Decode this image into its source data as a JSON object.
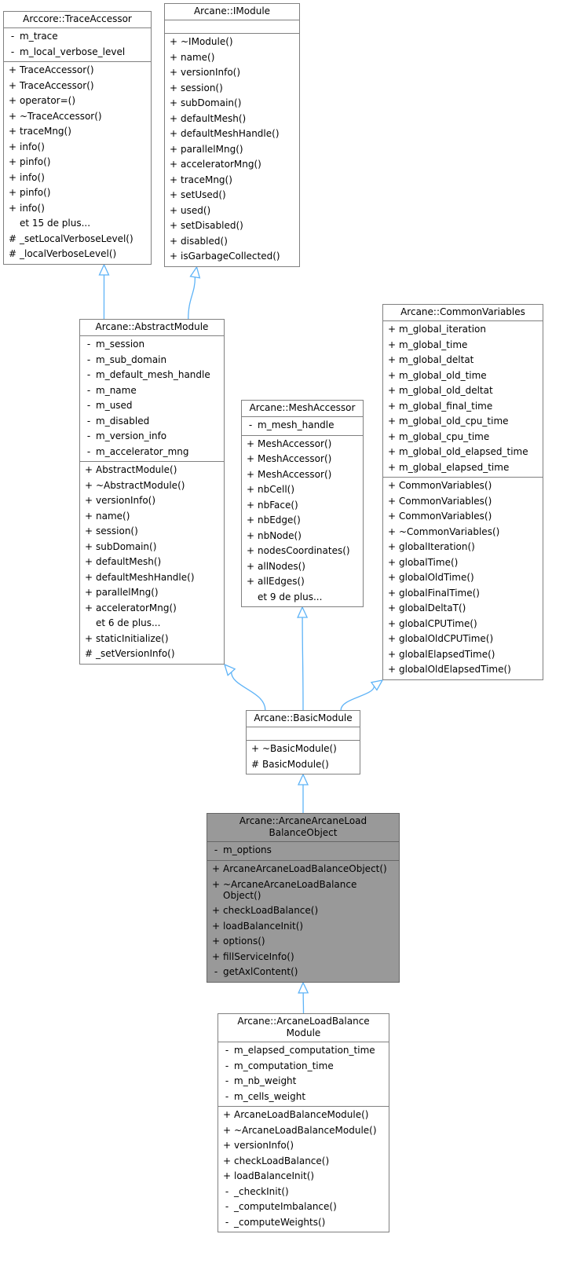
{
  "diagram": {
    "edge_color": "#5eb3f7",
    "classes": {
      "trace_accessor": {
        "title": "Arccore::TraceAccessor",
        "attributes": [
          {
            "vis": "-",
            "name": "m_trace"
          },
          {
            "vis": "-",
            "name": "m_local_verbose_level"
          }
        ],
        "methods": [
          {
            "vis": "+",
            "name": "TraceAccessor()"
          },
          {
            "vis": "+",
            "name": "TraceAccessor()"
          },
          {
            "vis": "+",
            "name": "operator=()"
          },
          {
            "vis": "+",
            "name": "~TraceAccessor()"
          },
          {
            "vis": "+",
            "name": "traceMng()"
          },
          {
            "vis": "+",
            "name": "info()"
          },
          {
            "vis": "+",
            "name": "pinfo()"
          },
          {
            "vis": "+",
            "name": "info()"
          },
          {
            "vis": "+",
            "name": "pinfo()"
          },
          {
            "vis": "+",
            "name": "info()"
          },
          {
            "vis": "",
            "name": "et 15 de plus..."
          },
          {
            "vis": "#",
            "name": "_setLocalVerboseLevel()"
          },
          {
            "vis": "#",
            "name": "_localVerboseLevel()"
          }
        ]
      },
      "imodule": {
        "title": "Arcane::IModule",
        "attributes": [],
        "methods": [
          {
            "vis": "+",
            "name": "~IModule()"
          },
          {
            "vis": "+",
            "name": "name()"
          },
          {
            "vis": "+",
            "name": "versionInfo()"
          },
          {
            "vis": "+",
            "name": "session()"
          },
          {
            "vis": "+",
            "name": "subDomain()"
          },
          {
            "vis": "+",
            "name": "defaultMesh()"
          },
          {
            "vis": "+",
            "name": "defaultMeshHandle()"
          },
          {
            "vis": "+",
            "name": "parallelMng()"
          },
          {
            "vis": "+",
            "name": "acceleratorMng()"
          },
          {
            "vis": "+",
            "name": "traceMng()"
          },
          {
            "vis": "+",
            "name": "setUsed()"
          },
          {
            "vis": "+",
            "name": "used()"
          },
          {
            "vis": "+",
            "name": "setDisabled()"
          },
          {
            "vis": "+",
            "name": "disabled()"
          },
          {
            "vis": "+",
            "name": "isGarbageCollected()"
          }
        ]
      },
      "abstract_module": {
        "title": "Arcane::AbstractModule",
        "attributes": [
          {
            "vis": "-",
            "name": "m_session"
          },
          {
            "vis": "-",
            "name": "m_sub_domain"
          },
          {
            "vis": "-",
            "name": "m_default_mesh_handle"
          },
          {
            "vis": "-",
            "name": "m_name"
          },
          {
            "vis": "-",
            "name": "m_used"
          },
          {
            "vis": "-",
            "name": "m_disabled"
          },
          {
            "vis": "-",
            "name": "m_version_info"
          },
          {
            "vis": "-",
            "name": "m_accelerator_mng"
          }
        ],
        "methods": [
          {
            "vis": "+",
            "name": "AbstractModule()"
          },
          {
            "vis": "+",
            "name": "~AbstractModule()"
          },
          {
            "vis": "+",
            "name": "versionInfo()"
          },
          {
            "vis": "+",
            "name": "name()"
          },
          {
            "vis": "+",
            "name": "session()"
          },
          {
            "vis": "+",
            "name": "subDomain()"
          },
          {
            "vis": "+",
            "name": "defaultMesh()"
          },
          {
            "vis": "+",
            "name": "defaultMeshHandle()"
          },
          {
            "vis": "+",
            "name": "parallelMng()"
          },
          {
            "vis": "+",
            "name": "acceleratorMng()"
          },
          {
            "vis": "",
            "name": "et 6 de plus..."
          },
          {
            "vis": "+",
            "name": "staticInitialize()"
          },
          {
            "vis": "#",
            "name": "_setVersionInfo()"
          }
        ]
      },
      "mesh_accessor": {
        "title": "Arcane::MeshAccessor",
        "attributes": [
          {
            "vis": "-",
            "name": "m_mesh_handle"
          }
        ],
        "methods": [
          {
            "vis": "+",
            "name": "MeshAccessor()"
          },
          {
            "vis": "+",
            "name": "MeshAccessor()"
          },
          {
            "vis": "+",
            "name": "MeshAccessor()"
          },
          {
            "vis": "+",
            "name": "nbCell()"
          },
          {
            "vis": "+",
            "name": "nbFace()"
          },
          {
            "vis": "+",
            "name": "nbEdge()"
          },
          {
            "vis": "+",
            "name": "nbNode()"
          },
          {
            "vis": "+",
            "name": "nodesCoordinates()"
          },
          {
            "vis": "+",
            "name": "allNodes()"
          },
          {
            "vis": "+",
            "name": "allEdges()"
          },
          {
            "vis": "",
            "name": "et 9 de plus..."
          }
        ]
      },
      "common_variables": {
        "title": "Arcane::CommonVariables",
        "attributes": [
          {
            "vis": "+",
            "name": "m_global_iteration"
          },
          {
            "vis": "+",
            "name": "m_global_time"
          },
          {
            "vis": "+",
            "name": "m_global_deltat"
          },
          {
            "vis": "+",
            "name": "m_global_old_time"
          },
          {
            "vis": "+",
            "name": "m_global_old_deltat"
          },
          {
            "vis": "+",
            "name": "m_global_final_time"
          },
          {
            "vis": "+",
            "name": "m_global_old_cpu_time"
          },
          {
            "vis": "+",
            "name": "m_global_cpu_time"
          },
          {
            "vis": "+",
            "name": "m_global_old_elapsed_time"
          },
          {
            "vis": "+",
            "name": "m_global_elapsed_time"
          }
        ],
        "methods": [
          {
            "vis": "+",
            "name": "CommonVariables()"
          },
          {
            "vis": "+",
            "name": "CommonVariables()"
          },
          {
            "vis": "+",
            "name": "CommonVariables()"
          },
          {
            "vis": "+",
            "name": "~CommonVariables()"
          },
          {
            "vis": "+",
            "name": "globalIteration()"
          },
          {
            "vis": "+",
            "name": "globalTime()"
          },
          {
            "vis": "+",
            "name": "globalOldTime()"
          },
          {
            "vis": "+",
            "name": "globalFinalTime()"
          },
          {
            "vis": "+",
            "name": "globalDeltaT()"
          },
          {
            "vis": "+",
            "name": "globalCPUTime()"
          },
          {
            "vis": "+",
            "name": "globalOldCPUTime()"
          },
          {
            "vis": "+",
            "name": "globalElapsedTime()"
          },
          {
            "vis": "+",
            "name": "globalOldElapsedTime()"
          }
        ]
      },
      "basic_module": {
        "title": "Arcane::BasicModule",
        "attributes": [],
        "methods": [
          {
            "vis": "+",
            "name": "~BasicModule()"
          },
          {
            "vis": "#",
            "name": "BasicModule()"
          }
        ]
      },
      "load_balance_object": {
        "title": "Arcane::ArcaneArcaneLoad\nBalanceObject",
        "attributes": [
          {
            "vis": "-",
            "name": "m_options"
          }
        ],
        "methods": [
          {
            "vis": "+",
            "name": "ArcaneArcaneLoadBalanceObject()"
          },
          {
            "vis": "+",
            "name": "~ArcaneArcaneLoadBalance\nObject()"
          },
          {
            "vis": "+",
            "name": "checkLoadBalance()"
          },
          {
            "vis": "+",
            "name": "loadBalanceInit()"
          },
          {
            "vis": "+",
            "name": "options()"
          },
          {
            "vis": "+",
            "name": "fillServiceInfo()"
          },
          {
            "vis": "-",
            "name": "getAxlContent()"
          }
        ]
      },
      "load_balance_module": {
        "title": "Arcane::ArcaneLoadBalance\nModule",
        "attributes": [
          {
            "vis": "-",
            "name": "m_elapsed_computation_time"
          },
          {
            "vis": "-",
            "name": "m_computation_time"
          },
          {
            "vis": "-",
            "name": "m_nb_weight"
          },
          {
            "vis": "-",
            "name": "m_cells_weight"
          }
        ],
        "methods": [
          {
            "vis": "+",
            "name": "ArcaneLoadBalanceModule()"
          },
          {
            "vis": "+",
            "name": "~ArcaneLoadBalanceModule()"
          },
          {
            "vis": "+",
            "name": "versionInfo()"
          },
          {
            "vis": "+",
            "name": "checkLoadBalance()"
          },
          {
            "vis": "+",
            "name": "loadBalanceInit()"
          },
          {
            "vis": "-",
            "name": "_checkInit()"
          },
          {
            "vis": "-",
            "name": "_computeImbalance()"
          },
          {
            "vis": "-",
            "name": "_computeWeights()"
          }
        ]
      }
    },
    "inheritance": [
      {
        "from": "abstract_module",
        "to": "trace_accessor"
      },
      {
        "from": "abstract_module",
        "to": "imodule"
      },
      {
        "from": "basic_module",
        "to": "abstract_module"
      },
      {
        "from": "basic_module",
        "to": "mesh_accessor"
      },
      {
        "from": "basic_module",
        "to": "common_variables"
      },
      {
        "from": "load_balance_object",
        "to": "basic_module"
      },
      {
        "from": "load_balance_module",
        "to": "load_balance_object"
      }
    ]
  }
}
